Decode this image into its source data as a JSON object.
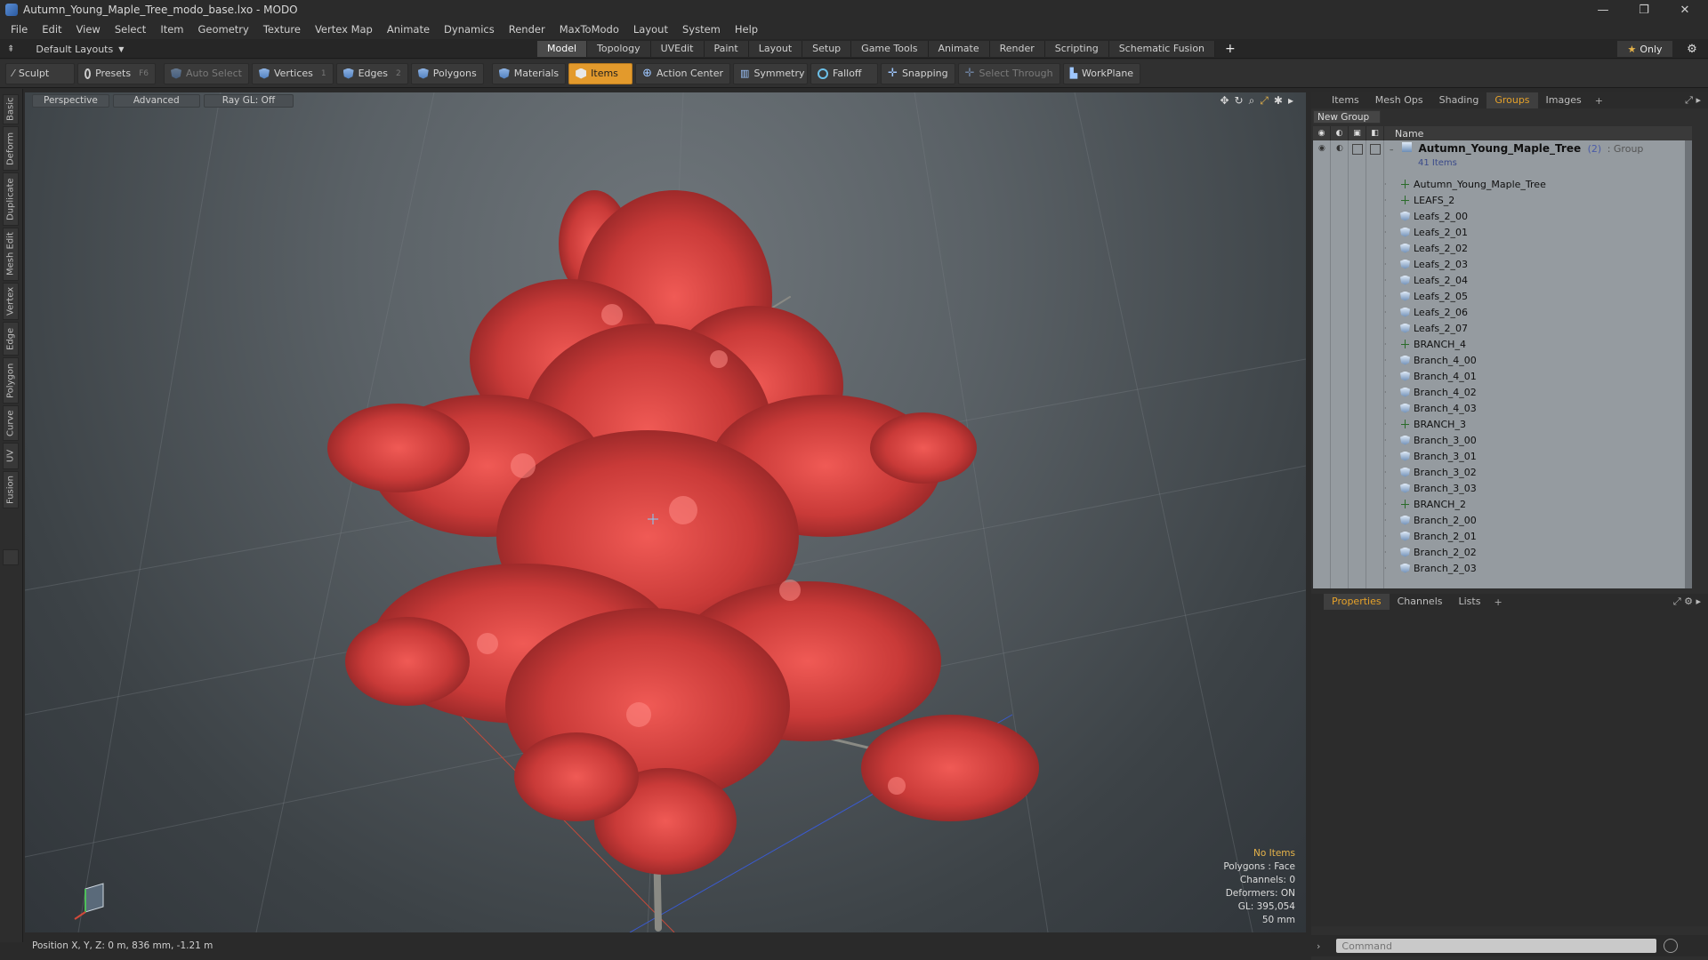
{
  "titlebar": {
    "title": "Autumn_Young_Maple_Tree_modo_base.lxo - MODO",
    "minimize": "—",
    "restore": "❐",
    "close": "✕"
  },
  "menu": [
    "File",
    "Edit",
    "View",
    "Select",
    "Item",
    "Geometry",
    "Texture",
    "Vertex Map",
    "Animate",
    "Dynamics",
    "Render",
    "MaxToModo",
    "Layout",
    "System",
    "Help"
  ],
  "layoutbar": {
    "layout_label": "Default Layouts",
    "mode_tabs": [
      "Model",
      "Topology",
      "UVEdit",
      "Paint",
      "Layout",
      "Setup",
      "Game Tools",
      "Animate",
      "Render",
      "Scripting",
      "Schematic Fusion"
    ],
    "active_mode": "Model",
    "plus": "+",
    "only_label": "Only"
  },
  "toolbar": {
    "sculpt": "Sculpt",
    "presets": "Presets",
    "presets_key": "F6",
    "auto_select": "Auto Select",
    "vertices": "Vertices",
    "vertices_key": "1",
    "edges": "Edges",
    "edges_key": "2",
    "polygons": "Polygons",
    "materials": "Materials",
    "items": "Items",
    "action_center": "Action Center",
    "symmetry": "Symmetry",
    "falloff": "Falloff",
    "snapping": "Snapping",
    "select_through": "Select Through",
    "workplane": "WorkPlane"
  },
  "lefttabs": [
    "Basic",
    "Deform",
    "Duplicate",
    "Mesh Edit",
    "Vertex",
    "Edge",
    "Polygon",
    "Curve",
    "UV",
    "Fusion"
  ],
  "viewport": {
    "perspective": "Perspective",
    "advanced": "Advanced",
    "raygl": "Ray GL: Off",
    "info_selection": "No Items",
    "info_polygons": "Polygons : Face",
    "info_channels": "Channels: 0",
    "info_deformers": "Deformers: ON",
    "info_gl": "GL: 395,054",
    "info_scale": "50 mm"
  },
  "statusbar": {
    "position": "Position X, Y, Z:  0 m, 836 mm, -1.21 m"
  },
  "itemlist": {
    "tabs": [
      "Items",
      "Mesh Ops",
      "Shading",
      "Groups",
      "Images"
    ],
    "active_tab": "Groups",
    "new_group": "New Group",
    "header_name": "Name",
    "group_name": "Autumn_Young_Maple_Tree",
    "group_count": "(2)",
    "group_type": ": Group",
    "group_items": "41 Items",
    "rows": [
      {
        "name": "Autumn_Young_Maple_Tree",
        "kind": "locator"
      },
      {
        "name": "LEAFS_2",
        "kind": "locator"
      },
      {
        "name": "Leafs_2_00",
        "kind": "mesh"
      },
      {
        "name": "Leafs_2_01",
        "kind": "mesh"
      },
      {
        "name": "Leafs_2_02",
        "kind": "mesh"
      },
      {
        "name": "Leafs_2_03",
        "kind": "mesh"
      },
      {
        "name": "Leafs_2_04",
        "kind": "mesh"
      },
      {
        "name": "Leafs_2_05",
        "kind": "mesh"
      },
      {
        "name": "Leafs_2_06",
        "kind": "mesh"
      },
      {
        "name": "Leafs_2_07",
        "kind": "mesh"
      },
      {
        "name": "BRANCH_4",
        "kind": "locator"
      },
      {
        "name": "Branch_4_00",
        "kind": "mesh"
      },
      {
        "name": "Branch_4_01",
        "kind": "mesh"
      },
      {
        "name": "Branch_4_02",
        "kind": "mesh"
      },
      {
        "name": "Branch_4_03",
        "kind": "mesh"
      },
      {
        "name": "BRANCH_3",
        "kind": "locator"
      },
      {
        "name": "Branch_3_00",
        "kind": "mesh"
      },
      {
        "name": "Branch_3_01",
        "kind": "mesh"
      },
      {
        "name": "Branch_3_02",
        "kind": "mesh"
      },
      {
        "name": "Branch_3_03",
        "kind": "mesh"
      },
      {
        "name": "BRANCH_2",
        "kind": "locator"
      },
      {
        "name": "Branch_2_00",
        "kind": "mesh"
      },
      {
        "name": "Branch_2_01",
        "kind": "mesh"
      },
      {
        "name": "Branch_2_02",
        "kind": "mesh"
      },
      {
        "name": "Branch_2_03",
        "kind": "mesh"
      }
    ]
  },
  "properties": {
    "tabs": [
      "Properties",
      "Channels",
      "Lists"
    ],
    "active_tab": "Properties"
  },
  "command": {
    "placeholder": "Command"
  },
  "colors": {
    "accent": "#e39a2c",
    "leaf": "#d9423f"
  }
}
